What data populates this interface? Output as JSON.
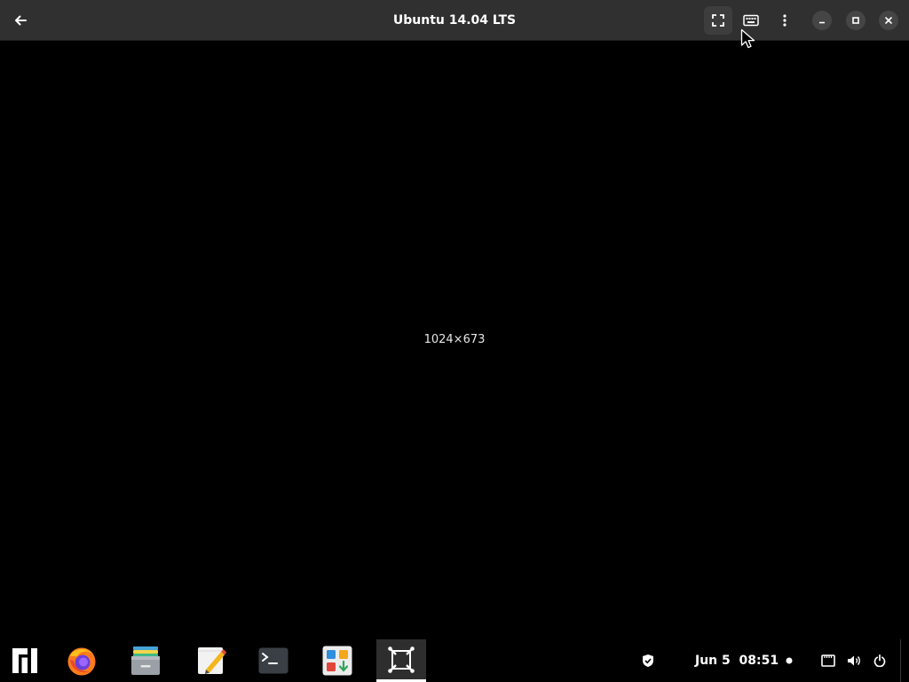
{
  "window": {
    "title": "Ubuntu 14.04 LTS"
  },
  "header": {
    "buttons": [
      {
        "name": "back",
        "icon": "arrow-left-icon"
      },
      {
        "name": "fullscreen",
        "icon": "fullscreen-icon"
      },
      {
        "name": "keyboard",
        "icon": "keyboard-icon"
      },
      {
        "name": "menu",
        "icon": "vertical-dots-icon"
      },
      {
        "name": "minimize",
        "icon": "minimize-icon"
      },
      {
        "name": "maximize",
        "icon": "maximize-icon"
      },
      {
        "name": "close",
        "icon": "close-icon"
      }
    ]
  },
  "viewport": {
    "resolution": "1024×673"
  },
  "taskbar": {
    "apps": [
      {
        "name": "manjaro-menu",
        "icon": "manjaro-logo-icon"
      },
      {
        "name": "firefox",
        "icon": "firefox-icon"
      },
      {
        "name": "files",
        "icon": "file-manager-icon"
      },
      {
        "name": "text-editor",
        "icon": "text-editor-icon"
      },
      {
        "name": "terminal",
        "icon": "terminal-icon"
      },
      {
        "name": "software",
        "icon": "software-store-icon"
      },
      {
        "name": "boxes",
        "icon": "virtual-machine-icon",
        "active": true
      }
    ],
    "clock": {
      "date": "Jun 5",
      "time": "08:51"
    },
    "tray": [
      {
        "name": "security",
        "icon": "shield-icon"
      },
      {
        "name": "notification",
        "icon": "dot-icon"
      },
      {
        "name": "network",
        "icon": "network-icon"
      },
      {
        "name": "volume",
        "icon": "speaker-icon"
      },
      {
        "name": "power",
        "icon": "power-icon"
      }
    ]
  },
  "colors": {
    "header_bg": "#303030",
    "viewport_bg": "#000000",
    "taskbar_bg": "#000000",
    "active_app_bg": "#2e2e2e"
  }
}
